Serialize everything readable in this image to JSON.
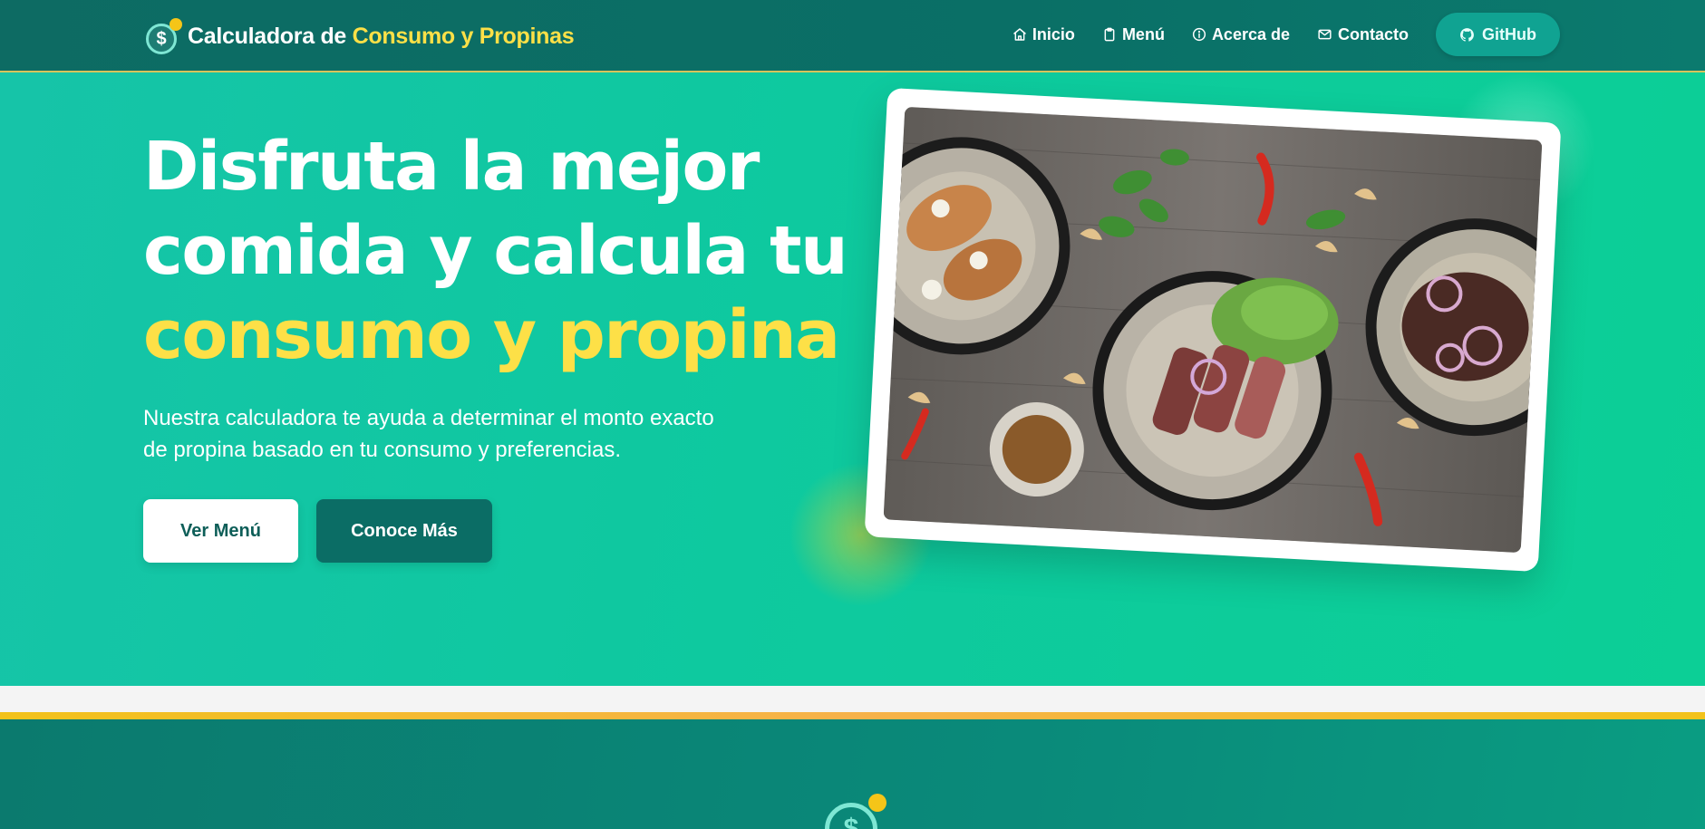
{
  "brand": {
    "prefix": "Calculadora de ",
    "accent": "Consumo y Propinas",
    "logo_icon": "dollar-coin-icon"
  },
  "nav": {
    "items": [
      {
        "label": "Inicio",
        "icon": "home-icon"
      },
      {
        "label": "Menú",
        "icon": "clipboard-icon"
      },
      {
        "label": "Acerca de",
        "icon": "info-icon"
      },
      {
        "label": "Contacto",
        "icon": "mail-icon"
      }
    ],
    "github_label": "GitHub"
  },
  "hero": {
    "title_line1": "Disfruta la mejor",
    "title_line2": "comida y calcula tu",
    "title_accent": "consumo y propina",
    "description": "Nuestra calculadora te ayuda a determinar el monto exacto de propina basado en tu consumo y preferencias.",
    "primary_button": "Ver Menú",
    "secondary_button": "Conoce Más",
    "image_icon": "food-plates-image"
  },
  "colors": {
    "header": "#0d6b63",
    "hero": "#10c9a0",
    "accent": "#fde047",
    "button_dark": "#0b6d65",
    "gold_line": "#f2c21a"
  }
}
